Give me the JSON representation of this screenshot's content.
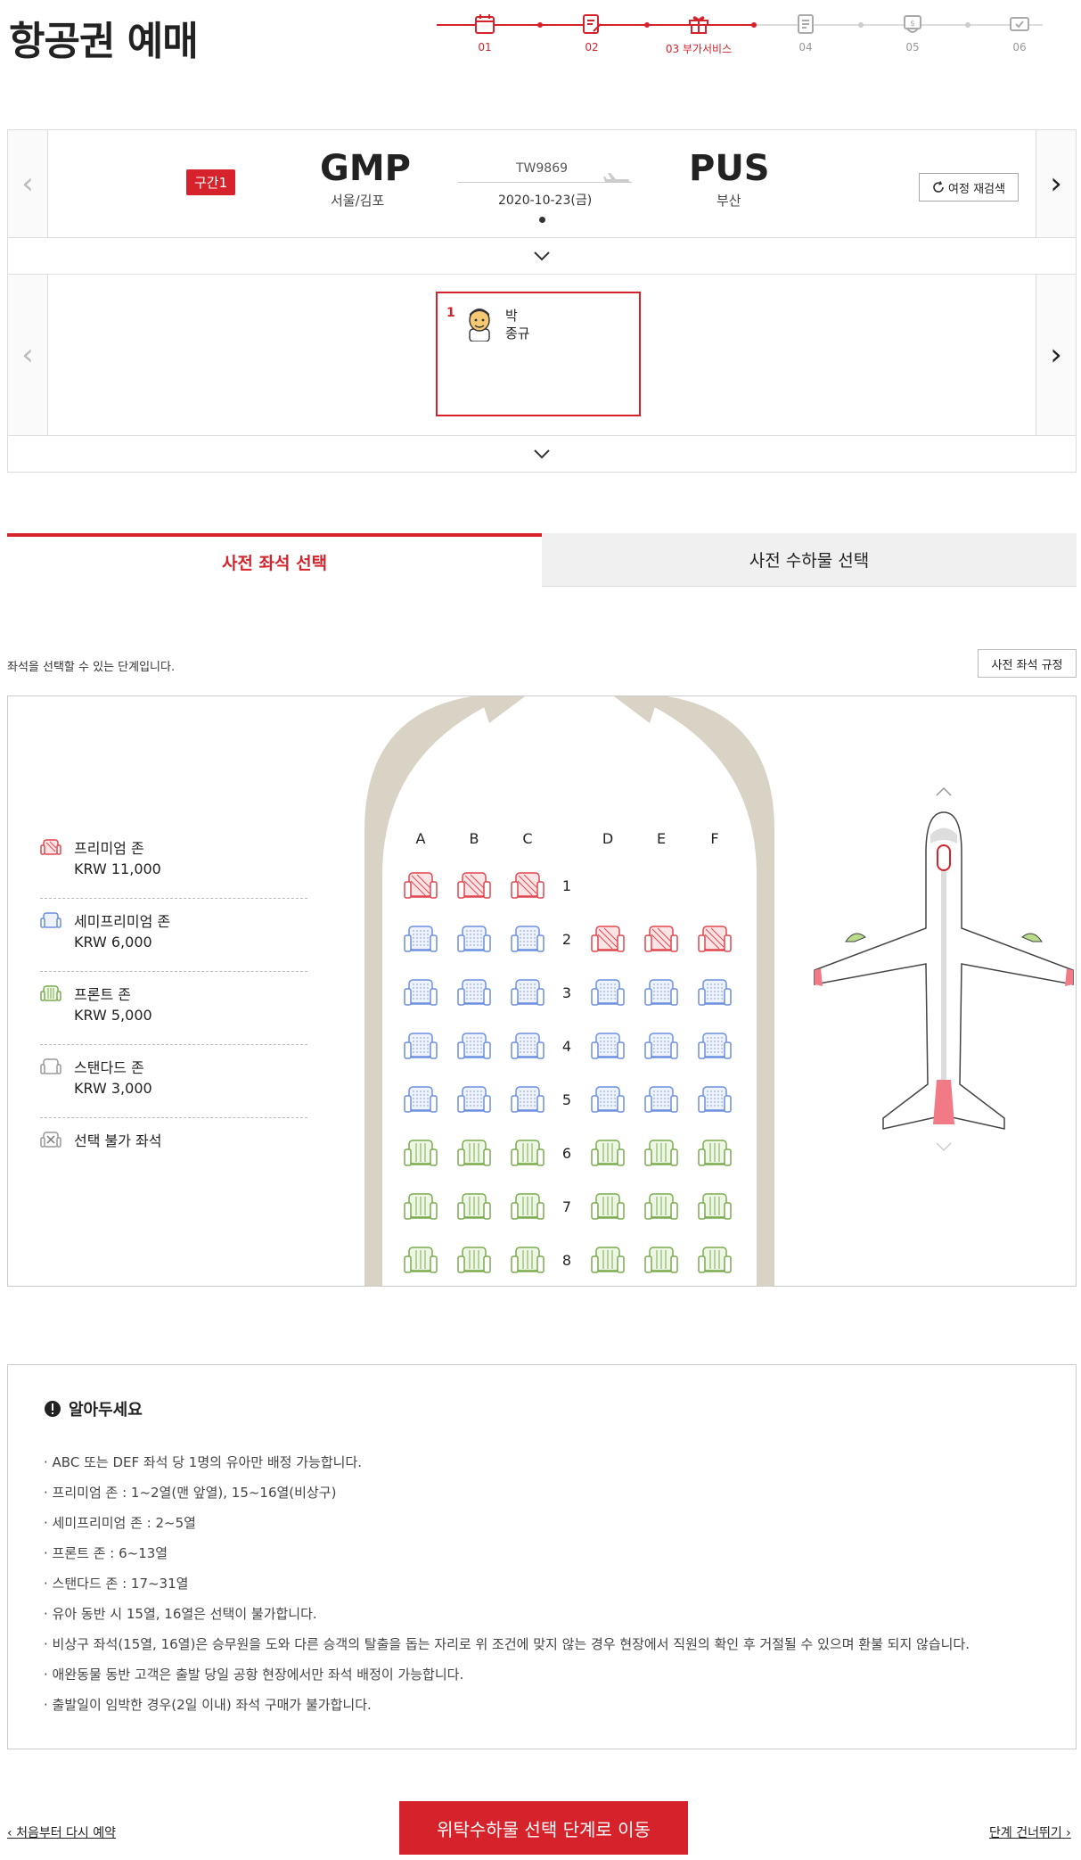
{
  "page": {
    "title": "항공권 예매"
  },
  "steps": [
    {
      "label": "01",
      "state": "on",
      "icon": "calendar-icon"
    },
    {
      "label": "02",
      "state": "on",
      "icon": "edit-document-icon"
    },
    {
      "label": "03 부가서비스",
      "state": "on",
      "icon": "gift-icon"
    },
    {
      "label": "04",
      "state": "off",
      "icon": "checklist-icon"
    },
    {
      "label": "05",
      "state": "off",
      "icon": "payment-icon"
    },
    {
      "label": "06",
      "state": "off",
      "icon": "ticket-confirm-icon"
    }
  ],
  "route": {
    "segment_badge": "구간1",
    "from_code": "GMP",
    "from_city": "서울/김포",
    "to_code": "PUS",
    "to_city": "부산",
    "flight_no": "TW9869",
    "date": "2020-10-23(금)",
    "research_label": "여정 재검색"
  },
  "passenger": {
    "index": "1",
    "surname": "박",
    "given": "종규"
  },
  "tabs": {
    "seat": "사전 좌석 선택",
    "baggage": "사전 수하물 선택"
  },
  "seat_section": {
    "description": "좌석을 선택할 수 있는 단계입니다.",
    "rule_button": "사전 좌석 규정"
  },
  "legend": [
    {
      "name": "프리미엄 존",
      "price": "KRW 11,000",
      "color": "#e0474f",
      "type": "premium"
    },
    {
      "name": "세미프리미엄 존",
      "price": "KRW 6,000",
      "color": "#6d8fe0",
      "type": "semi"
    },
    {
      "name": "프론트 존",
      "price": "KRW 5,000",
      "color": "#7aac4e",
      "type": "front"
    },
    {
      "name": "스탠다드 존",
      "price": "KRW 3,000",
      "color": "#999999",
      "type": "standard"
    },
    {
      "name": "선택 불가 좌석",
      "price": "",
      "color": "#999999",
      "type": "unavailable"
    }
  ],
  "seat_map": {
    "columns": [
      "A",
      "B",
      "C",
      "D",
      "E",
      "F"
    ],
    "rows": [
      {
        "num": "1",
        "seats": [
          "premium",
          "premium",
          "premium",
          "",
          "",
          ""
        ]
      },
      {
        "num": "2",
        "seats": [
          "semi",
          "semi",
          "semi",
          "premium",
          "premium",
          "premium"
        ]
      },
      {
        "num": "3",
        "seats": [
          "semi",
          "semi",
          "semi",
          "semi",
          "semi",
          "semi"
        ]
      },
      {
        "num": "4",
        "seats": [
          "semi",
          "semi",
          "semi",
          "semi",
          "semi",
          "semi"
        ]
      },
      {
        "num": "5",
        "seats": [
          "semi",
          "semi",
          "semi",
          "semi",
          "semi",
          "semi"
        ]
      },
      {
        "num": "6",
        "seats": [
          "front",
          "front",
          "front",
          "front",
          "front",
          "front"
        ]
      },
      {
        "num": "7",
        "seats": [
          "front",
          "front",
          "front",
          "front",
          "front",
          "front"
        ]
      },
      {
        "num": "8",
        "seats": [
          "front",
          "front",
          "front",
          "front",
          "front",
          "front"
        ]
      }
    ]
  },
  "notice": {
    "title": "알아두세요",
    "items": [
      "ABC 또는 DEF 좌석 당 1명의 유아만 배정 가능합니다.",
      "프리미엄 존 : 1~2열(맨 앞열), 15~16열(비상구)",
      "세미프리미엄 존 : 2~5열",
      "프론트 존 : 6~13열",
      "스탠다드 존 : 17~31열",
      "유아 동반 시 15열, 16열은 선택이 불가합니다.",
      "비상구 좌석(15열, 16열)은 승무원을 도와 다른 승객의 탈출을 돕는 자리로 위 조건에 맞지 않는 경우 현장에서 직원의 확인 후 거절될 수 있으며 환불 되지 않습니다.",
      "애완동물 동반 고객은 출발 당일 공항 현장에서만 좌석 배정이 가능합니다.",
      "출발일이 임박한 경우(2일 이내) 좌석 구매가 불가합니다."
    ]
  },
  "footer": {
    "restart": "처음부터 다시 예약",
    "next": "위탁수하물 선택 단계로 이동",
    "skip": "단계 건너뛰기"
  }
}
